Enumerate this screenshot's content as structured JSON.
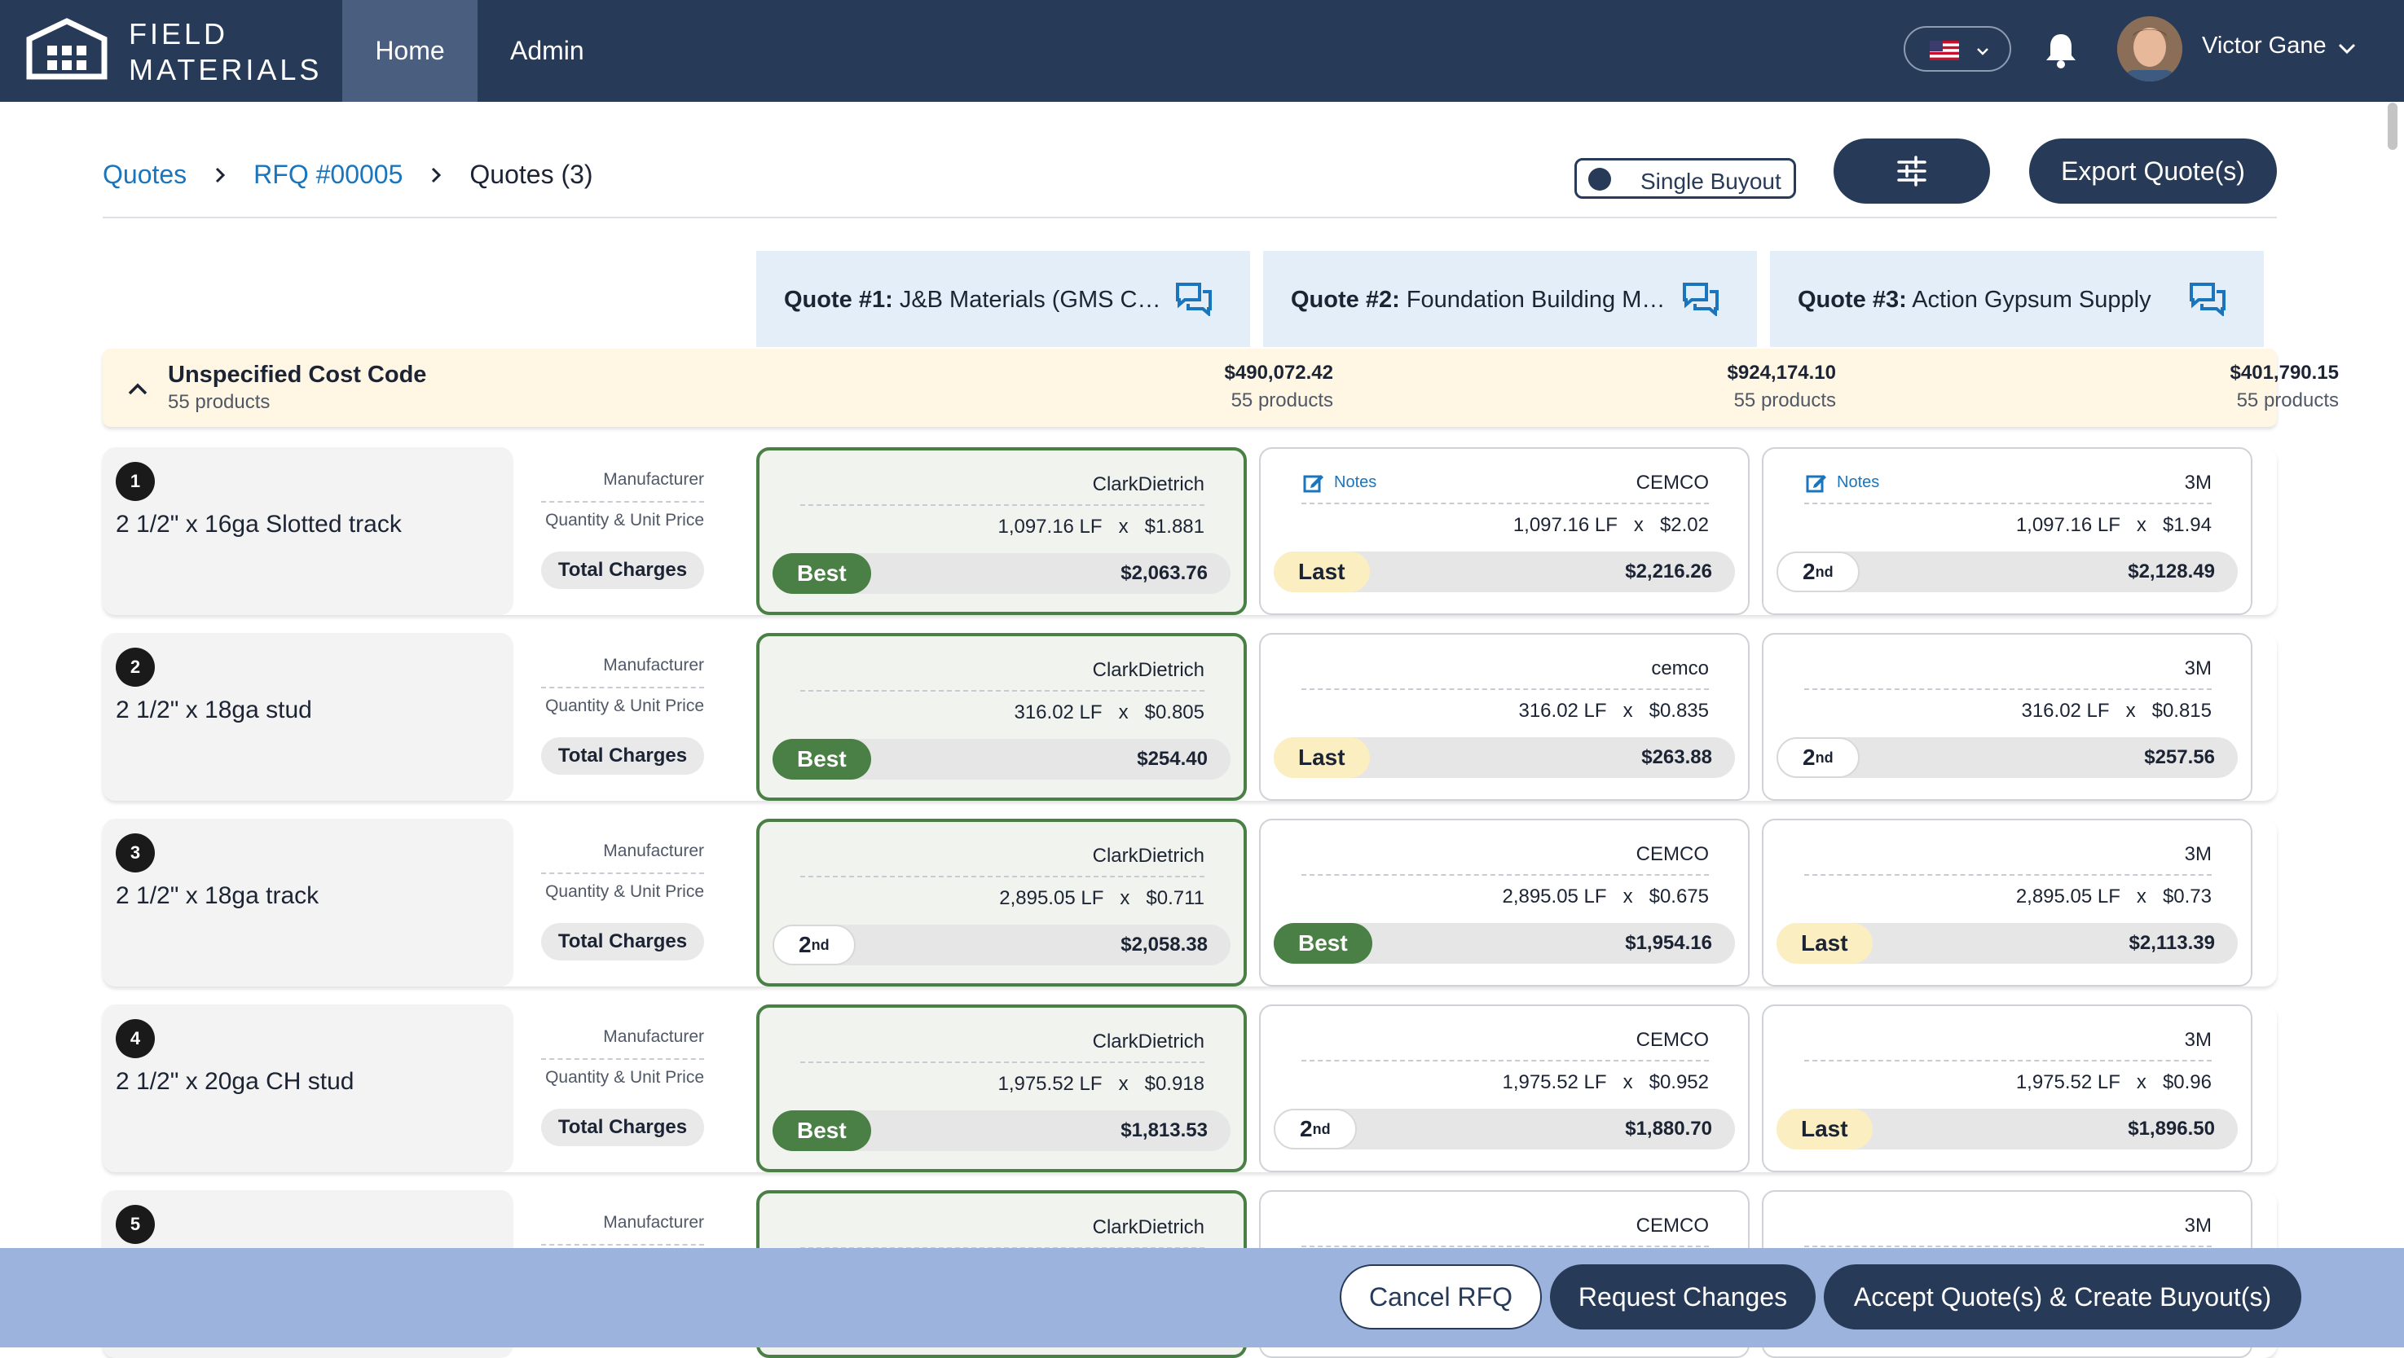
{
  "app": {
    "brand_line1": "FIELD",
    "brand_line2": "MATERIALS"
  },
  "nav": {
    "home": "Home",
    "admin": "Admin"
  },
  "user": {
    "name": "Victor Gane"
  },
  "breadcrumb": {
    "root": "Quotes",
    "rfq": "RFQ #00005",
    "current": "Quotes (3)"
  },
  "toolbar": {
    "toggle_label": "Single Buyout",
    "export_label": "Export Quote(s)"
  },
  "quotes": [
    {
      "number": "Quote #1:",
      "vendor": "J&B Materials (GMS Co..."
    },
    {
      "number": "Quote #2:",
      "vendor": "Foundation Building Mat..."
    },
    {
      "number": "Quote #3:",
      "vendor": "Action Gypsum Supply"
    }
  ],
  "cost_code": {
    "title": "Unspecified Cost Code",
    "count": "55 products",
    "totals": [
      {
        "amount": "$490,072.42",
        "count": "55 products"
      },
      {
        "amount": "$924,174.10",
        "count": "55 products"
      },
      {
        "amount": "$401,790.15",
        "count": "55 products"
      }
    ]
  },
  "labels": {
    "manufacturer": "Manufacturer",
    "qty_price": "Quantity & Unit Price",
    "total_charges": "Total Charges",
    "notes": "Notes"
  },
  "products": [
    {
      "num": "1",
      "name": "2 1/2\" x 16ga Slotted track",
      "quotes": [
        {
          "manufacturer": "ClarkDietrich",
          "qty": "1,097.16 LF",
          "price": "$1.881",
          "rank": "Best",
          "total": "$2,063.76",
          "notes": false
        },
        {
          "manufacturer": "CEMCO",
          "qty": "1,097.16 LF",
          "price": "$2.02",
          "rank": "Last",
          "total": "$2,216.26",
          "notes": true
        },
        {
          "manufacturer": "3M",
          "qty": "1,097.16 LF",
          "price": "$1.94",
          "rank": "2nd",
          "total": "$2,128.49",
          "notes": true
        }
      ]
    },
    {
      "num": "2",
      "name": "2 1/2\" x 18ga stud",
      "quotes": [
        {
          "manufacturer": "ClarkDietrich",
          "qty": "316.02 LF",
          "price": "$0.805",
          "rank": "Best",
          "total": "$254.40",
          "notes": false
        },
        {
          "manufacturer": "cemco",
          "qty": "316.02 LF",
          "price": "$0.835",
          "rank": "Last",
          "total": "$263.88",
          "notes": false
        },
        {
          "manufacturer": "3M",
          "qty": "316.02 LF",
          "price": "$0.815",
          "rank": "2nd",
          "total": "$257.56",
          "notes": false
        }
      ]
    },
    {
      "num": "3",
      "name": "2 1/2\" x 18ga track",
      "quotes": [
        {
          "manufacturer": "ClarkDietrich",
          "qty": "2,895.05 LF",
          "price": "$0.711",
          "rank": "2nd",
          "total": "$2,058.38",
          "notes": false
        },
        {
          "manufacturer": "CEMCO",
          "qty": "2,895.05 LF",
          "price": "$0.675",
          "rank": "Best",
          "total": "$1,954.16",
          "notes": false
        },
        {
          "manufacturer": "3M",
          "qty": "2,895.05 LF",
          "price": "$0.73",
          "rank": "Last",
          "total": "$2,113.39",
          "notes": false
        }
      ]
    },
    {
      "num": "4",
      "name": "2 1/2\" x 20ga CH stud",
      "quotes": [
        {
          "manufacturer": "ClarkDietrich",
          "qty": "1,975.52 LF",
          "price": "$0.918",
          "rank": "Best",
          "total": "$1,813.53",
          "notes": false
        },
        {
          "manufacturer": "CEMCO",
          "qty": "1,975.52 LF",
          "price": "$0.952",
          "rank": "2nd",
          "total": "$1,880.70",
          "notes": false
        },
        {
          "manufacturer": "3M",
          "qty": "1,975.52 LF",
          "price": "$0.96",
          "rank": "Last",
          "total": "$1,896.50",
          "notes": false
        }
      ]
    },
    {
      "num": "5",
      "name": "",
      "quotes": [
        {
          "manufacturer": "ClarkDietrich",
          "qty": "",
          "price": "",
          "rank": "",
          "total": "",
          "notes": false
        },
        {
          "manufacturer": "CEMCO",
          "qty": "",
          "price": "",
          "rank": "",
          "total": "",
          "notes": false
        },
        {
          "manufacturer": "3M",
          "qty": "",
          "price": "",
          "rank": "",
          "total": "",
          "notes": false
        }
      ]
    }
  ],
  "actions": {
    "cancel": "Cancel RFQ",
    "request_changes": "Request Changes",
    "accept": "Accept Quote(s) & Create Buyout(s)"
  },
  "colors": {
    "nav": "#273a58",
    "accent_link": "#1b75bc",
    "best": "#4a7f45",
    "last": "#fbeec0",
    "quote_header": "#e3eef9",
    "cost_code_bg": "#fff6e4",
    "action_bar": "#9cb4dd"
  }
}
